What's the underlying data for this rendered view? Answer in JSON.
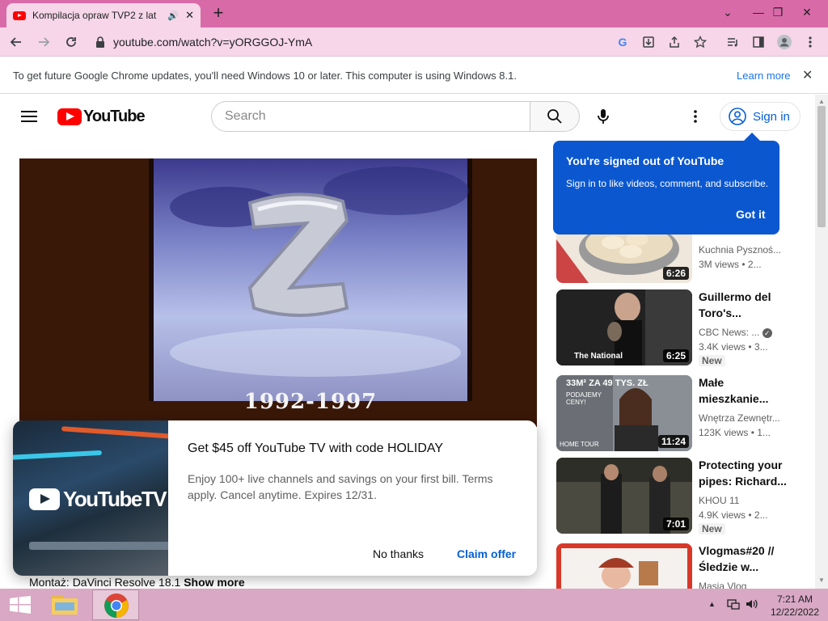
{
  "browser": {
    "tab": {
      "title": "Kompilacja opraw TVP2 z lat",
      "favicon": "youtube-icon",
      "audio_icon": "speaker-icon"
    },
    "new_tab_label": "+",
    "url": "youtube.com/watch?v=yORGGOJ-YmA",
    "window_controls": {
      "minimize": "—",
      "maximize": "❐",
      "close": "✕",
      "tab_search": "⌄"
    },
    "infobar": {
      "message": "To get future Google Chrome updates, you'll need Windows 10 or later. This computer is using Windows 8.1.",
      "link": "Learn more"
    }
  },
  "youtube": {
    "logo_text": "YouTube",
    "search_placeholder": "Search",
    "sign_in_label": "Sign in",
    "tooltip": {
      "title": "You're signed out of YouTube",
      "body": "Sign in to like videos, comment, and subscribe.",
      "button": "Got it"
    },
    "video": {
      "overlay_text": "1992-1997"
    },
    "description": {
      "text": "Montaż: DaVinci Resolve 18.1",
      "show_more": "Show more"
    },
    "promo": {
      "logo_text": "YouTubeTV",
      "title": "Get $45 off YouTube TV with code HOLIDAY",
      "body": "Enjoy 100+ live channels and savings on your first bill. Terms apply. Cancel anytime. Expires 12/31.",
      "dismiss": "No thanks",
      "claim": "Claim offer"
    },
    "sidebar": [
      {
        "title": "",
        "channel": "Kuchnia Pysznoś...",
        "views": "3M views",
        "age": "2...",
        "duration": "6:26",
        "new": ""
      },
      {
        "title": "Guillermo del Toro's...",
        "channel": "CBC News: ...",
        "views": "3.4K views",
        "age": "3...",
        "duration": "6:25",
        "new": "New",
        "thumb_caption": "The National"
      },
      {
        "title": "Małe mieszkanie...",
        "channel": "Wnętrza Zewnętr...",
        "views": "123K views",
        "age": "1...",
        "duration": "11:24",
        "new": "",
        "thumb_caption": "33M² ZA 49 TYS. ZŁ",
        "thumb_sub": "PODAJEMY CENY!",
        "thumb_corner": "HOME TOUR"
      },
      {
        "title": "Protecting your pipes: Richard...",
        "channel": "KHOU 11",
        "views": "4.9K views",
        "age": "2...",
        "duration": "7:01",
        "new": "New"
      },
      {
        "title": "Vlogmas#20 // Śledzie w...",
        "channel": "Masia Vlog",
        "views": "",
        "age": "",
        "duration": "",
        "new": ""
      }
    ]
  },
  "taskbar": {
    "time": "7:21 AM",
    "date": "12/22/2022"
  }
}
